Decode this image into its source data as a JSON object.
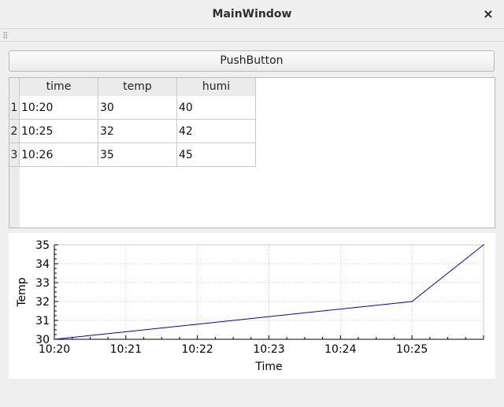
{
  "window": {
    "title": "MainWindow",
    "close_glyph": "×"
  },
  "push_button": {
    "label": "PushButton"
  },
  "table": {
    "columns": [
      "time",
      "temp",
      "humi"
    ],
    "rows": [
      {
        "header": "1",
        "cells": [
          "10:20",
          "30",
          "40"
        ]
      },
      {
        "header": "2",
        "cells": [
          "10:25",
          "32",
          "42"
        ]
      },
      {
        "header": "3",
        "cells": [
          "10:26",
          "35",
          "45"
        ]
      }
    ]
  },
  "chart_data": {
    "type": "line",
    "title": "",
    "xlabel": "Time",
    "ylabel": "Temp",
    "x": [
      "10:20",
      "10:25",
      "10:26"
    ],
    "series": [
      {
        "values": [
          30,
          32,
          35
        ],
        "color": "#0000cc"
      }
    ],
    "xlim": [
      "10:20",
      "10:26"
    ],
    "ylim": [
      30,
      35
    ],
    "xticks": [
      "10:20",
      "10:21",
      "10:22",
      "10:23",
      "10:24",
      "10:25"
    ],
    "yticks": [
      30,
      31,
      32,
      33,
      34,
      35
    ],
    "grid": true
  }
}
